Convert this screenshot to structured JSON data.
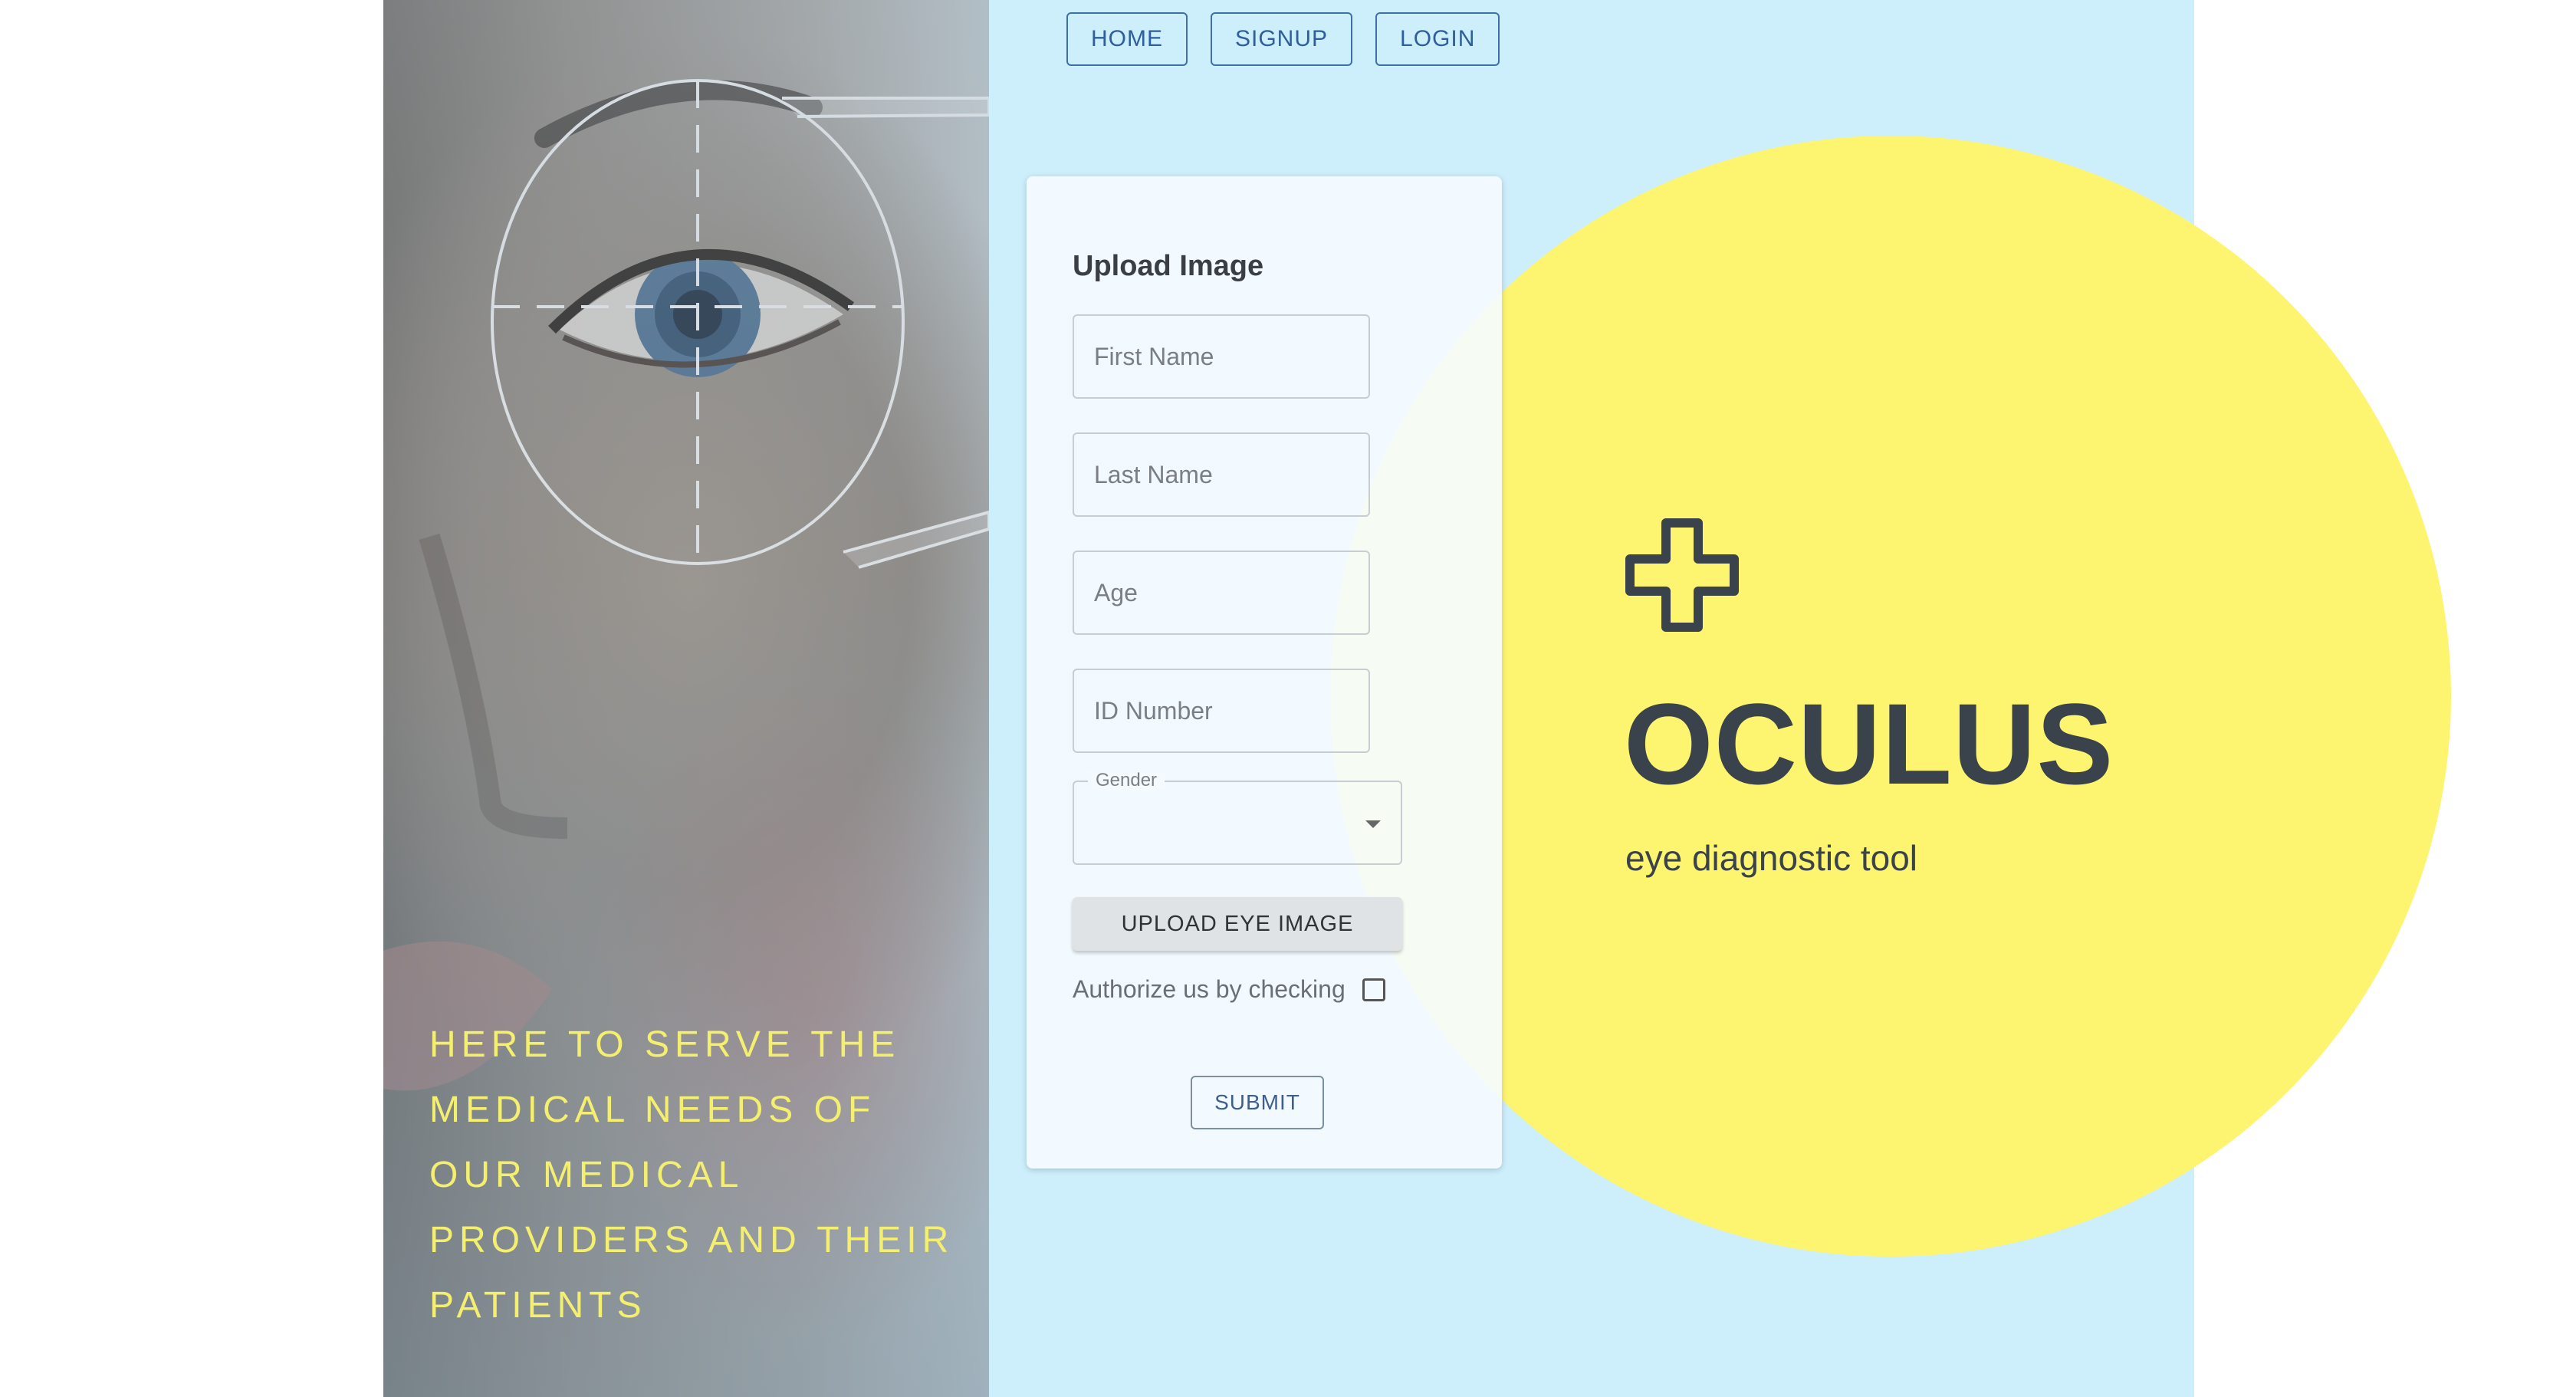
{
  "nav": {
    "home": "HOME",
    "signup": "SIGNUP",
    "login": "LOGIN"
  },
  "hero": {
    "tagline": "HERE TO SERVE THE MEDICAL NEEDS OF OUR MEDICAL PROVIDERS AND THEIR PATIENTS"
  },
  "form": {
    "title": "Upload Image",
    "first_name_placeholder": "First Name",
    "last_name_placeholder": "Last Name",
    "age_placeholder": "Age",
    "id_number_placeholder": "ID Number",
    "gender_label": "Gender",
    "gender_value": "",
    "upload_label": "UPLOAD EYE IMAGE",
    "authorize_label": "Authorize us by checking",
    "authorize_checked": false,
    "submit_label": "SUBMIT"
  },
  "brand": {
    "icon": "medical-cross-icon",
    "name": "OCULUS",
    "tagline": "eye diagnostic tool"
  },
  "colors": {
    "panel_blue": "#cdeefb",
    "accent_yellow": "#fdf56f",
    "tagline_yellow": "#f4ef6e",
    "brand_text": "#3a424c",
    "nav_border": "#3e70a9"
  }
}
